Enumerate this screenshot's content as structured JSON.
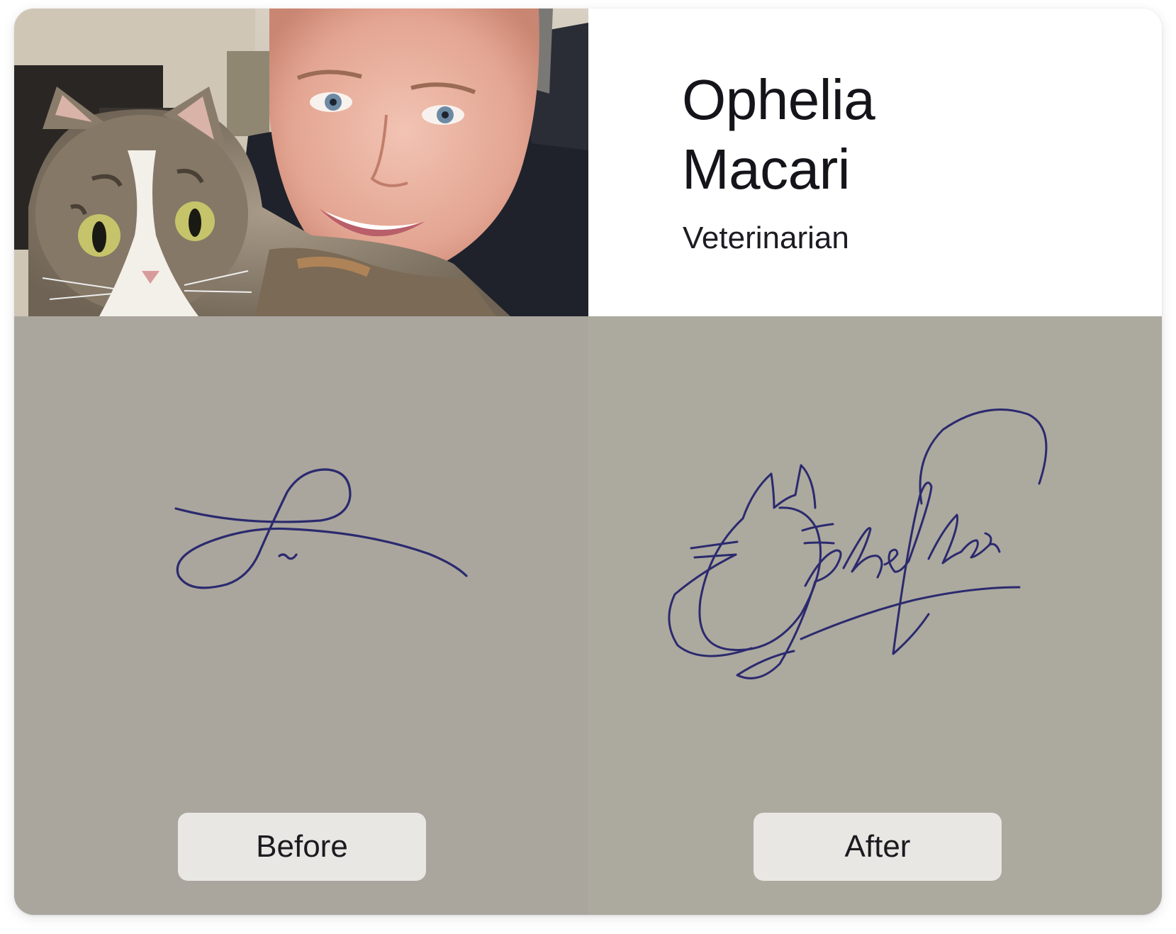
{
  "profile": {
    "first_name": "Ophelia",
    "last_name": "Macari",
    "role": "Veterinarian",
    "photo_subject": "woman-with-cat-photo"
  },
  "comparison": {
    "before_label": "Before",
    "after_label": "After",
    "before_signature": "Original signature",
    "after_signature": "Ophelia"
  },
  "colors": {
    "paper": "#aaa69e",
    "ink": "#2b2a6e",
    "label_bg": "#e8e7e4",
    "name_text": "#14141a"
  }
}
